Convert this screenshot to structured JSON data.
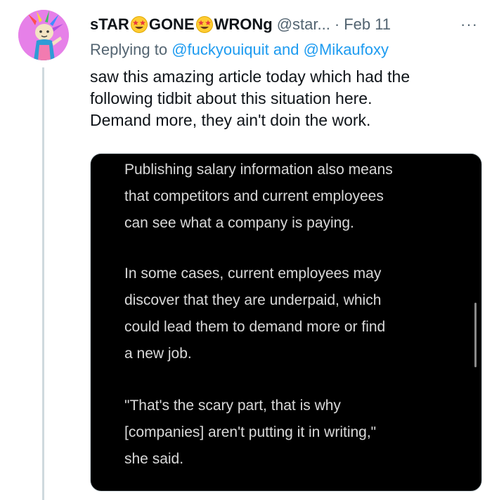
{
  "tweet": {
    "author": {
      "name_part1": "sTAR",
      "name_part2": "GONE",
      "name_part3": "WRONg",
      "name_emoji": "star-struck-emoji",
      "handle": "@star...",
      "avatar": "avatar-cartoon-character"
    },
    "separator": "·",
    "date": "Feb 11",
    "more_label": "···",
    "replying": {
      "prefix": "Replying to ",
      "mention1": "@fuckyouiquit",
      "and": " and ",
      "mention2": "@Mikaufoxy"
    },
    "text_lines": [
      "saw this amazing article today which had the",
      "following tidbit about this situation here.",
      "Demand more, they ain't doin the work."
    ],
    "media": {
      "paragraphs": [
        [
          "Publishing salary information also means",
          "that competitors and current employees",
          "can see what a company is paying."
        ],
        [
          "In some cases, current employees may",
          "discover that they are underpaid, which",
          "could lead them to demand more or find",
          "a new job."
        ],
        [
          "\"That's the scary part, that is why",
          "[companies] aren't putting it in writing,\"",
          "she said."
        ]
      ]
    }
  },
  "colors": {
    "text_primary": "#0f1419",
    "text_secondary": "#536471",
    "link": "#1d9bf0",
    "thread_line": "#cfd9de",
    "media_bg": "#000000",
    "media_text": "#d9d9d9",
    "avatar_bg": "#e680e8"
  }
}
